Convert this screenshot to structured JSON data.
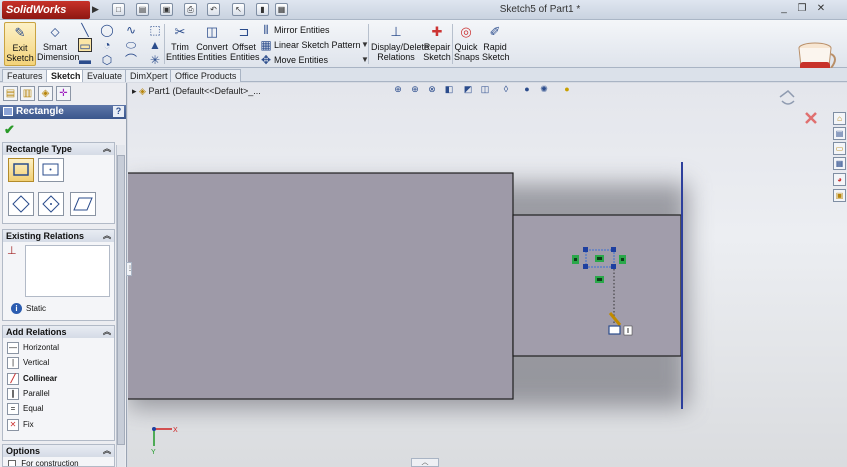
{
  "app": {
    "name": "SolidWorks",
    "document_title": "Sketch5 of Part1 *"
  },
  "ribbon": {
    "exit_sketch": "Exit Sketch",
    "smart_dimension": "Smart Dimension",
    "trim_entities": "Trim Entities",
    "convert_entities": "Convert Entities",
    "offset_entities": "Offset Entities",
    "mirror_entities": "Mirror Entities",
    "linear_sketch_pattern": "Linear Sketch Pattern",
    "move_entities": "Move Entities",
    "display_delete_relations": "Display/Delete Relations",
    "repair_sketch": "Repair Sketch",
    "quick_snaps": "Quick Snaps",
    "rapid_sketch": "Rapid Sketch"
  },
  "tabs": [
    "Features",
    "Sketch",
    "Evaluate",
    "DimXpert",
    "Office Products"
  ],
  "active_tab": "Sketch",
  "property_manager": {
    "title": "Rectangle",
    "help": "?",
    "rectangle_type": {
      "header": "Rectangle Type"
    },
    "existing_relations": {
      "header": "Existing Relations",
      "status": "Static"
    },
    "add_relations": {
      "header": "Add Relations",
      "items": [
        "Horizontal",
        "Vertical",
        "Collinear",
        "Parallel",
        "Equal",
        "Fix"
      ]
    },
    "options": {
      "header": "Options",
      "for_construction": "For construction"
    }
  },
  "feature_tree": {
    "root": "Part1  (Default<<Default>_..."
  },
  "triad": {
    "x": "X",
    "y": "Y"
  },
  "colors": {
    "part_face": "#9e9aa8",
    "sketch_line": "#2d3f9c",
    "relation_marker": "#2aa84a",
    "title_bar": "#c9d3e0",
    "active_highlight": "#f3d37a"
  }
}
